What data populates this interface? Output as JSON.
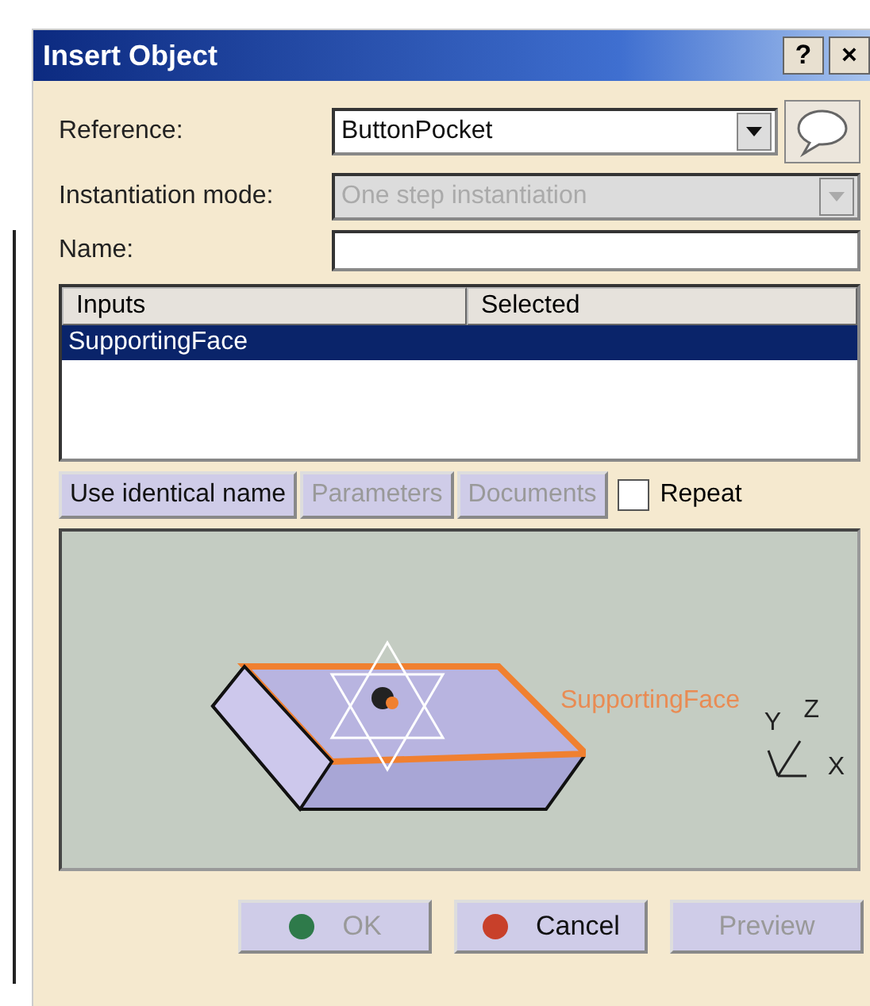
{
  "window": {
    "title": "Insert Object",
    "help_button": "?",
    "close_button": "×"
  },
  "reference": {
    "label": "Reference:",
    "value": "ButtonPocket"
  },
  "instantiation_mode": {
    "label": "Instantiation mode:",
    "value": "One step instantiation",
    "disabled": true
  },
  "name": {
    "label": "Name:"
  },
  "inputs_table": {
    "columns": [
      "Inputs",
      "Selected"
    ],
    "rows": [
      {
        "input": "SupportingFace",
        "selected": true
      }
    ]
  },
  "actions": [
    {
      "label": "Use identical name",
      "disabled": false
    },
    {
      "label": "Parameters",
      "disabled": true
    },
    {
      "label": "Documents",
      "disabled": true
    }
  ],
  "repeat": {
    "label": "Repeat",
    "checked": false
  },
  "preview": {
    "face_label": "SupportingFace",
    "axes": [
      "Y",
      "Z",
      "X"
    ]
  },
  "buttons": [
    {
      "label": "OK",
      "kind": "ok",
      "disabled": true
    },
    {
      "label": "Cancel",
      "kind": "cancel",
      "disabled": false
    },
    {
      "label": "Preview",
      "kind": "plain",
      "disabled": true
    }
  ]
}
